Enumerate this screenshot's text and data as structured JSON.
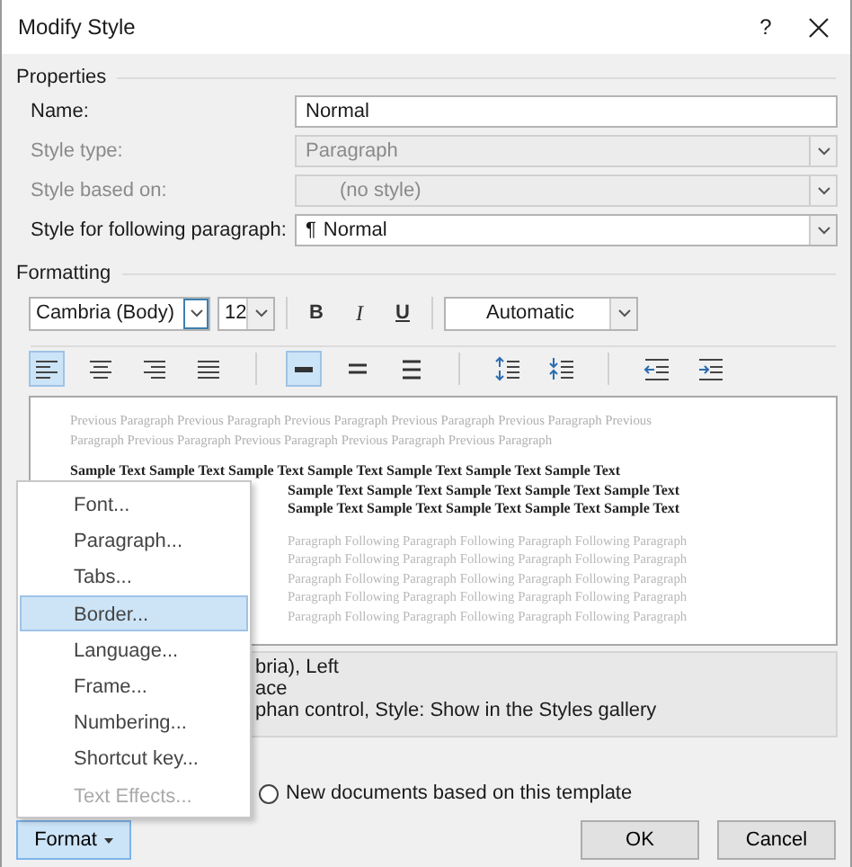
{
  "window": {
    "title": "Modify Style",
    "help": "?"
  },
  "properties": {
    "heading": "Properties",
    "fields": [
      {
        "label": "Name:",
        "kind": "text",
        "value": "Normal",
        "disabled": false
      },
      {
        "label": "Style type:",
        "kind": "dropdown",
        "value": "Paragraph",
        "disabled": true
      },
      {
        "label": "Style based on:",
        "kind": "dropdown",
        "value": "(no style)",
        "disabled": true
      },
      {
        "label": "Style for following paragraph:",
        "kind": "dropdown",
        "symbol": "¶",
        "value": "Normal",
        "disabled": false
      }
    ]
  },
  "formatting": {
    "heading": "Formatting",
    "font": "Cambria (Body)",
    "size": "12",
    "bold": "B",
    "italic": "I",
    "underline": "U",
    "font_color_setting": "Automatic",
    "button_groups": [
      [
        {
          "kind": "align-left",
          "selected": true
        },
        {
          "kind": "align-center",
          "selected": false
        },
        {
          "kind": "align-right",
          "selected": false
        },
        {
          "kind": "justify",
          "selected": false
        }
      ],
      [
        {
          "kind": "single-spacing",
          "selected": true
        },
        {
          "kind": "one-half-spacing",
          "selected": false
        },
        {
          "kind": "double-spacing",
          "selected": false
        }
      ],
      [
        {
          "kind": "increase-spacing",
          "selected": false
        },
        {
          "kind": "decrease-spacing",
          "selected": false
        }
      ],
      [
        {
          "kind": "decrease-indent",
          "selected": false
        },
        {
          "kind": "increase-indent",
          "selected": false
        }
      ]
    ]
  },
  "preview": {
    "lines": [
      {
        "kind": "previous",
        "text": "Previous Paragraph Previous Paragraph Previous Paragraph Previous Paragraph Previous Paragraph Previous"
      },
      {
        "kind": "previous",
        "text": "Paragraph Previous Paragraph Previous Paragraph Previous Paragraph Previous Paragraph"
      },
      {
        "kind": "sample",
        "text": "Sample Text Sample Text Sample Text Sample Text Sample Text Sample Text Sample Text"
      },
      {
        "kind": "sample_covered",
        "text": "Sample Text Sample Text Sample Text Sample Text Sample Text"
      },
      {
        "kind": "sample_covered",
        "text": "Sample Text Sample Text Sample Text Sample Text Sample Text"
      },
      {
        "kind": "following_covered",
        "text": "Paragraph Following Paragraph Following Paragraph Following Paragraph"
      },
      {
        "kind": "following_covered",
        "text": "Paragraph Following Paragraph Following Paragraph Following Paragraph"
      },
      {
        "kind": "following_covered",
        "text": "Paragraph Following Paragraph Following Paragraph Following Paragraph"
      },
      {
        "kind": "following_covered",
        "text": "Paragraph Following Paragraph Following Paragraph Following Paragraph"
      },
      {
        "kind": "following_covered",
        "text": "Paragraph Following Paragraph Following Paragraph Following Paragraph"
      }
    ]
  },
  "description": [
    "bria), Left",
    "ace",
    "phan control, Style: Show in the Styles gallery"
  ],
  "radio": {
    "label": "New documents based on this template",
    "selected": false
  },
  "format_button": {
    "label": "Format",
    "expanded": true
  },
  "buttons": [
    "OK",
    "Cancel"
  ],
  "menu": [
    {
      "label": "Font...",
      "selected": false,
      "disabled": false
    },
    {
      "label": "Paragraph...",
      "selected": false,
      "disabled": false
    },
    {
      "label": "Tabs...",
      "selected": false,
      "disabled": false
    },
    {
      "label": "Border...",
      "selected": true,
      "disabled": false
    },
    {
      "label": "Language...",
      "selected": false,
      "disabled": false
    },
    {
      "label": "Frame...",
      "selected": false,
      "disabled": false
    },
    {
      "label": "Numbering...",
      "selected": false,
      "disabled": false
    },
    {
      "label": "Shortcut key...",
      "selected": false,
      "disabled": false
    },
    {
      "label": "Text Effects...",
      "selected": false,
      "disabled": true
    }
  ]
}
